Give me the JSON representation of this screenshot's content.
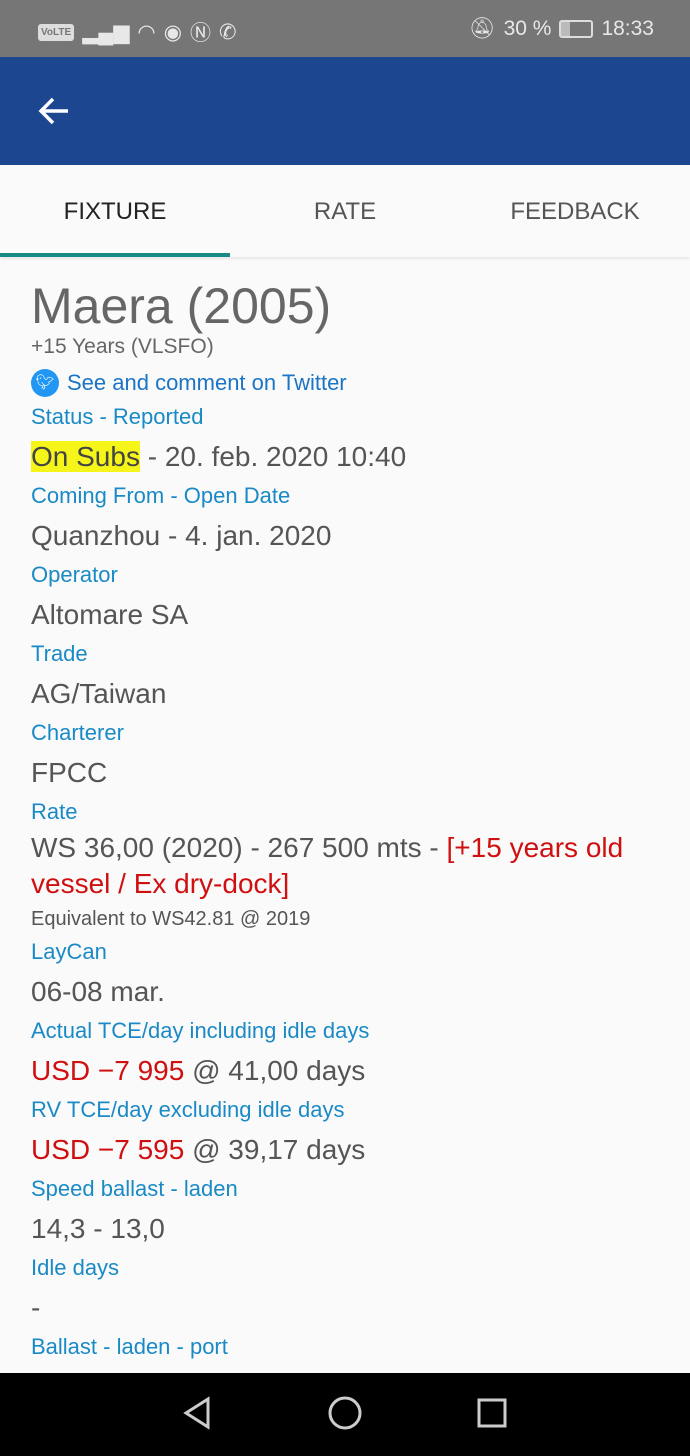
{
  "status_bar": {
    "left_icons": [
      "volte-icon",
      "signal-icon",
      "wifi-icon",
      "eye-icon",
      "nfc-icon",
      "whatsapp-icon"
    ],
    "volte": "VoLTE",
    "battery": "30 %",
    "time": "18:33"
  },
  "tabs": [
    {
      "label": "FIXTURE",
      "active": true
    },
    {
      "label": "RATE"
    },
    {
      "label": "FEEDBACK"
    }
  ],
  "vessel": {
    "name": "Maera (2005)",
    "subtitle": "+15 Years (VLSFO)",
    "twitter_link": "See and comment on Twitter"
  },
  "fields": {
    "status": {
      "label": "Status - Reported",
      "highlight": "On Subs",
      "value": " - 20. feb. 2020 10:40"
    },
    "coming_from": {
      "label": "Coming From - Open Date",
      "value": "Quanzhou - 4. jan. 2020"
    },
    "operator": {
      "label": "Operator",
      "value": "Altomare SA"
    },
    "trade": {
      "label": "Trade",
      "value": "AG/Taiwan"
    },
    "charterer": {
      "label": "Charterer",
      "value": "FPCC"
    },
    "rate": {
      "label": "Rate",
      "value": "WS 36,00 (2020) - 267 500 mts - ",
      "note": "[+15 years old vessel / Ex dry-dock]",
      "equivalent": "Equivalent to WS42.81 @ 2019"
    },
    "laycan": {
      "label": "LayCan",
      "value": "06-08 mar."
    },
    "actual_tce": {
      "label": "Actual TCE/day including idle days",
      "amount": "USD −7 995",
      "value": " @ 41,00 days"
    },
    "rv_tce": {
      "label": "RV TCE/day excluding idle days",
      "amount": "USD −7 595",
      "value": " @ 39,17 days"
    },
    "speed": {
      "label": "Speed ballast - laden",
      "value": "14,3 - 13,0"
    },
    "idle": {
      "label": "Idle days",
      "value": "-"
    },
    "ballast": {
      "label": "Ballast - laden - port"
    }
  },
  "colors": {
    "appbar": "#1c4690",
    "label": "#1a8ac6",
    "negative": "#d01010",
    "highlight": "#f5f51a",
    "tab_indicator": "#1a8b84"
  }
}
